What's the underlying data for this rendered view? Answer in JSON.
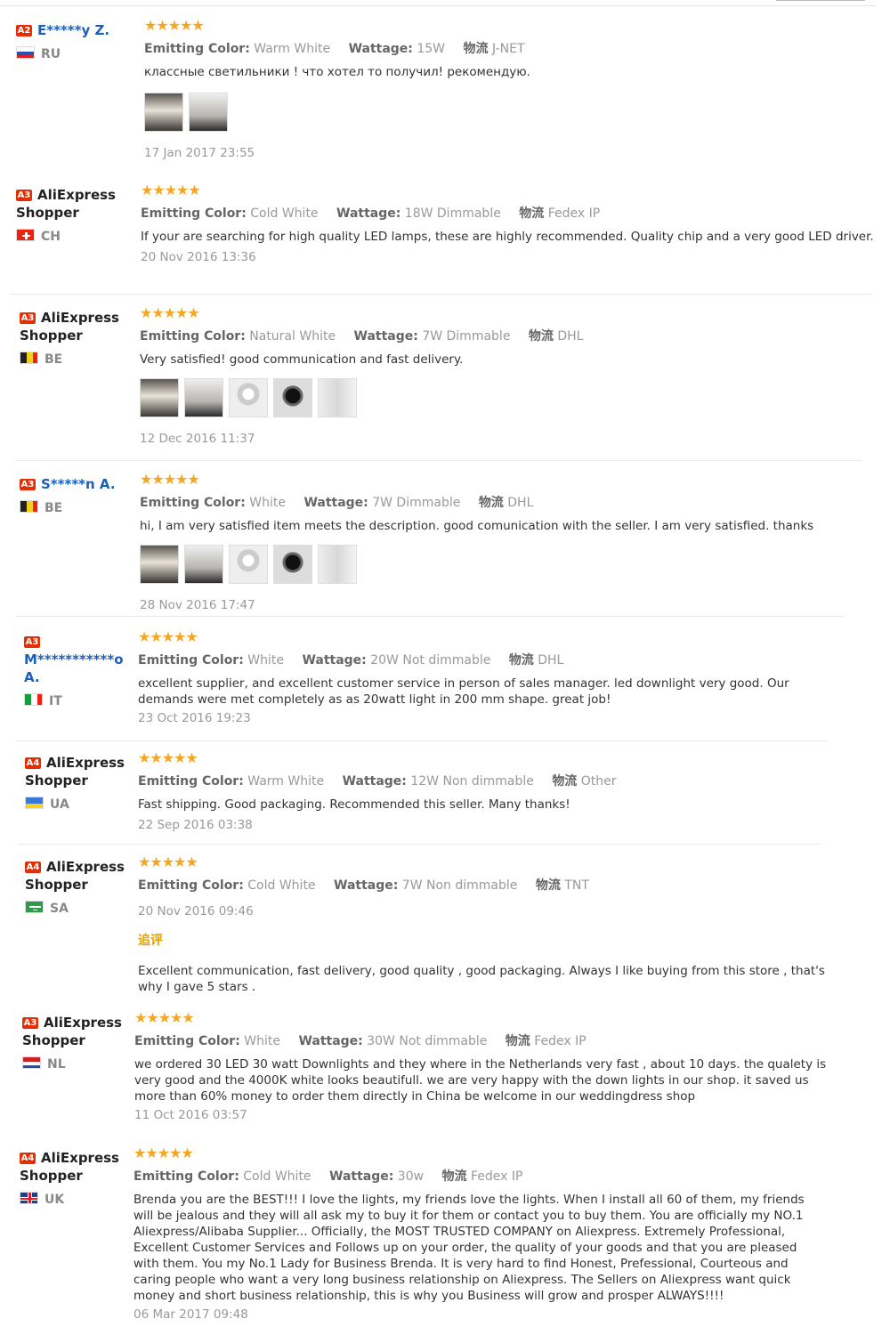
{
  "labels": {
    "color": "Emitting Color:",
    "wattage": "Wattage:",
    "shipping": "物流"
  },
  "reviews": [
    {
      "badge": "A2",
      "name": "E*****y Z.",
      "anon": true,
      "country": "RU",
      "stars": "★★★★★",
      "color": "Warm White",
      "wattage": "15W",
      "shipping": "J-NET",
      "text": "классные светильники ! что хотел то получил! рекомендую.",
      "photos": [
        "photo-1",
        "photo-2"
      ],
      "date": "17 Jan 2017 23:55"
    },
    {
      "badge": "A3",
      "name": "AliExpress Shopper",
      "anon": false,
      "country": "CH",
      "stars": "★★★★★",
      "color": "Cold White",
      "wattage": "18W Dimmable",
      "shipping": "Fedex IP",
      "text": "If your are searching for high quality LED lamps, these are highly recommended. Quality chip and a very good LED driver.",
      "photos": [],
      "date": "20 Nov 2016 13:36"
    },
    {
      "badge": "A3",
      "name": "AliExpress Shopper",
      "anon": false,
      "country": "BE",
      "stars": "★★★★★",
      "color": "Natural White",
      "wattage": "7W Dimmable",
      "shipping": "DHL",
      "text": "Very satisfied! good communication and fast delivery.",
      "photos": [
        "photo-1",
        "photo-2",
        "photo-3",
        "photo-4",
        "photo-5"
      ],
      "date": "12 Dec 2016 11:37"
    },
    {
      "badge": "A3",
      "name": "S*****n A.",
      "anon": true,
      "country": "BE",
      "stars": "★★★★★",
      "color": "White",
      "wattage": "7W Dimmable",
      "shipping": "DHL",
      "text": "hi, I am very satisfied item meets the description. good comunication with the seller. I am very satisfied. thanks",
      "photos": [
        "photo-1",
        "photo-2",
        "photo-3",
        "photo-4",
        "photo-5"
      ],
      "date": "28 Nov 2016 17:47"
    },
    {
      "badge": "A3",
      "name": "M***********o A.",
      "anon": true,
      "country": "IT",
      "stars": "★★★★★",
      "color": "White",
      "wattage": "20W Not dimmable",
      "shipping": "DHL",
      "text": "excellent supplier, and excellent customer service in person of sales manager. led downlight very good. Our demands were met completely as as 20watt light in 200 mm shape. great job!",
      "photos": [],
      "date": "23 Oct 2016 19:23"
    },
    {
      "badge": "A4",
      "name": "AliExpress Shopper",
      "anon": false,
      "country": "UA",
      "stars": "★★★★★",
      "color": "Warm White",
      "wattage": "12W Non dimmable",
      "shipping": "Other",
      "text": "Fast shipping. Good packaging. Recommended this seller. Many thanks!",
      "photos": [],
      "date": "22 Sep 2016 03:38"
    },
    {
      "badge": "A4",
      "name": "AliExpress Shopper",
      "anon": false,
      "country": "SA",
      "stars": "★★★★★",
      "color": "Cold White",
      "wattage": "7W Non dimmable",
      "shipping": "TNT",
      "text": "",
      "photos": [],
      "date": "20 Nov 2016 09:46",
      "additional_label": "追评",
      "additional_text": "Excellent communication, fast delivery, good quality , good packaging. Always I like buying from this store , that's why I gave 5 stars ."
    },
    {
      "badge": "A3",
      "name": "AliExpress Shopper",
      "anon": false,
      "country": "NL",
      "stars": "★★★★★",
      "color": "White",
      "wattage": "30W Not dimmable",
      "shipping": "Fedex IP",
      "text": "we ordered 30 LED 30 watt Downlights and they where in the Netherlands very fast , about 10 days. the qualety is very good and the 4000K white looks beautifull. we are very happy with the down lights in our shop. it saved us more than 60% money to order them directly in China be welcome in our weddingdress shop",
      "photos": [],
      "date": "11 Oct 2016 03:57"
    },
    {
      "badge": "A4",
      "name": "AliExpress Shopper",
      "anon": false,
      "country": "UK",
      "stars": "★★★★★",
      "color": "Cold White",
      "wattage": "30w",
      "shipping": "Fedex IP",
      "text": "Brenda you are the BEST!!! I love the lights, my friends love the lights. When I install all 60 of them, my friends will be jealous and they will all ask my to buy it for them or contact you to buy them. You are officially my NO.1 Aliexpress/Alibaba Supplier... Officially, the MOST TRUSTED COMPANY on Aliexpress. Extremely Professional, Excellent Customer Services and Follows up on your order, the quality of your goods and that you are pleased with them. You my No.1 Lady for Business Brenda. It is very hard to find Honest, Prefessional, Courteous and caring people who want a very long business relationship on Aliexpress. The Sellers on Aliexpress want quick money and short business relationship, this is why you Business will grow and prosper ALWAYS!!!!",
      "photos": [],
      "date": "06 Mar 2017 09:48"
    }
  ]
}
